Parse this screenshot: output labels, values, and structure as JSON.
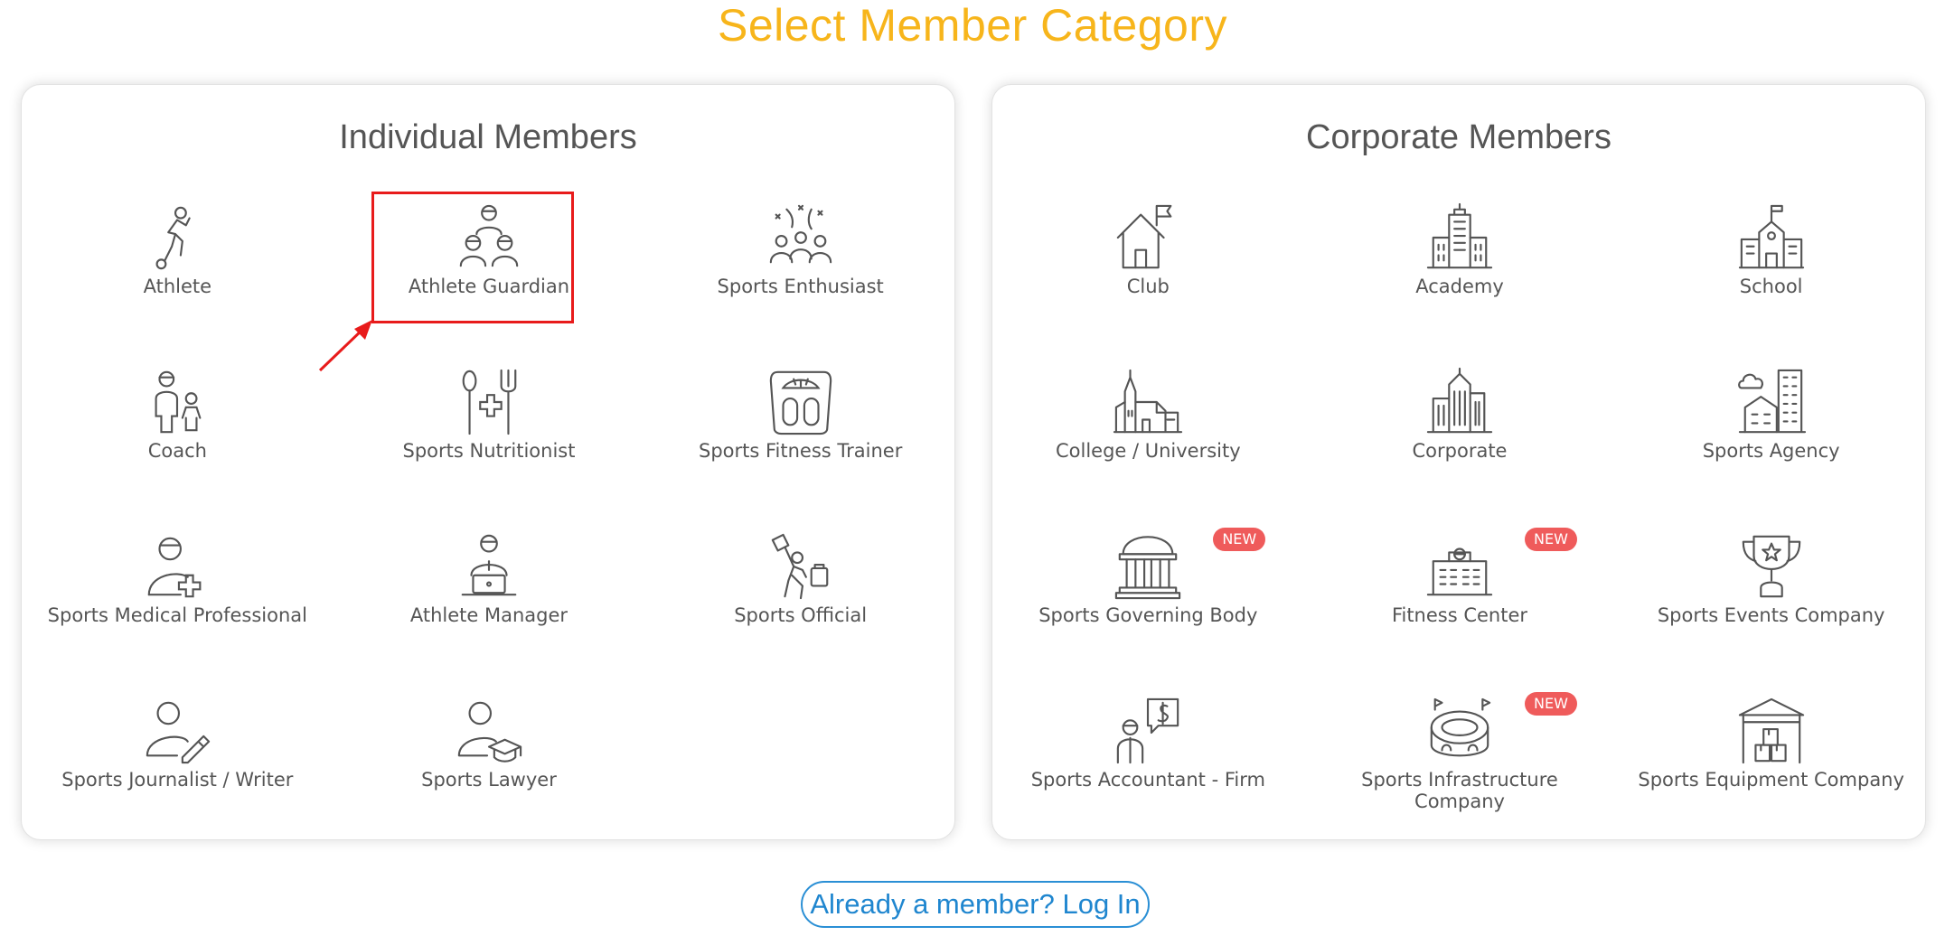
{
  "title": "Select Member Category",
  "colors": {
    "title": "#f7b51b",
    "badge": "#ef5b5b",
    "highlight": "#e81b1b",
    "link": "#1f86cf"
  },
  "individual": {
    "heading": "Individual Members",
    "items": [
      {
        "label": "Athlete",
        "icon": "athlete-icon"
      },
      {
        "label": "Athlete Guardian",
        "icon": "athlete-guardian-icon"
      },
      {
        "label": "Sports Enthusiast",
        "icon": "sports-enthusiast-icon"
      },
      {
        "label": "Coach",
        "icon": "coach-icon"
      },
      {
        "label": "Sports Nutritionist",
        "icon": "nutritionist-icon"
      },
      {
        "label": "Sports Fitness Trainer",
        "icon": "fitness-trainer-icon"
      },
      {
        "label": "Sports Medical Professional",
        "icon": "medical-professional-icon"
      },
      {
        "label": "Athlete Manager",
        "icon": "athlete-manager-icon"
      },
      {
        "label": "Sports Official",
        "icon": "sports-official-icon"
      },
      {
        "label": "Sports Journalist / Writer",
        "icon": "journalist-icon"
      },
      {
        "label": "Sports Lawyer",
        "icon": "lawyer-icon"
      }
    ]
  },
  "corporate": {
    "heading": "Corporate Members",
    "badge_text": "NEW",
    "items": [
      {
        "label": "Club",
        "icon": "club-icon"
      },
      {
        "label": "Academy",
        "icon": "academy-icon"
      },
      {
        "label": "School",
        "icon": "school-icon"
      },
      {
        "label": "College / University",
        "icon": "college-icon"
      },
      {
        "label": "Corporate",
        "icon": "corporate-icon"
      },
      {
        "label": "Sports Agency",
        "icon": "sports-agency-icon"
      },
      {
        "label": "Sports Governing Body",
        "icon": "governing-body-icon",
        "badge": "NEW"
      },
      {
        "label": "Fitness Center",
        "icon": "fitness-center-icon",
        "badge": "NEW"
      },
      {
        "label": "Sports Events Company",
        "icon": "events-company-icon"
      },
      {
        "label": "Sports Accountant - Firm",
        "icon": "accountant-icon"
      },
      {
        "label": "Sports Infrastructure Company",
        "icon": "infrastructure-icon",
        "badge": "NEW"
      },
      {
        "label": "Sports Equipment Company",
        "icon": "equipment-company-icon"
      }
    ]
  },
  "login_link": "Already a member? Log In"
}
